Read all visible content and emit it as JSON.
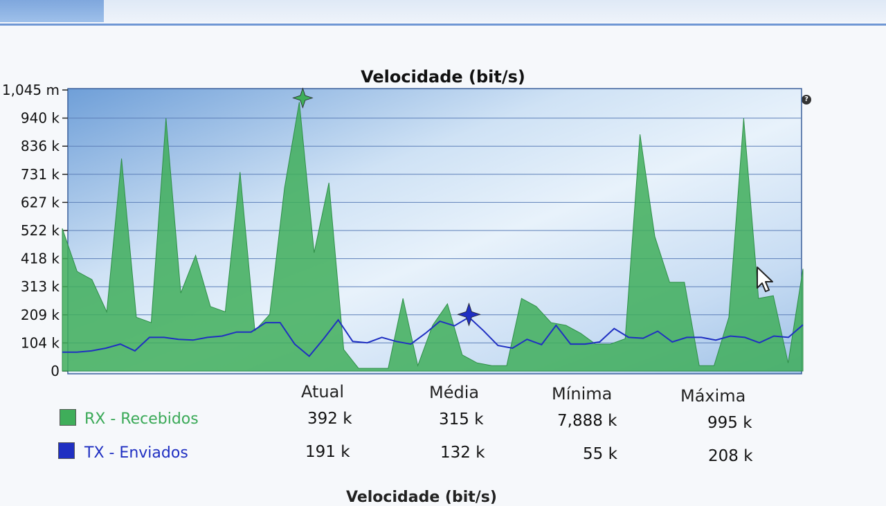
{
  "chart_data": {
    "type": "area",
    "title": "Velocidade (bit/s)",
    "y_ticks": [
      "1,045 m",
      "940 k",
      "836 k",
      "731 k",
      "627 k",
      "522 k",
      "418 k",
      "313 k",
      "209 k",
      "104 k",
      "0"
    ],
    "ylim": [
      0,
      1045000
    ],
    "grid": true,
    "legend_position": "bottom-left",
    "series": [
      {
        "name": "RX - Recebidos",
        "color": "#3fae5a",
        "values": [
          530000,
          370000,
          340000,
          220000,
          790000,
          200000,
          180000,
          940000,
          290000,
          430000,
          240000,
          220000,
          740000,
          150000,
          210000,
          680000,
          1000000,
          440000,
          700000,
          80000,
          10000,
          10000,
          10000,
          270000,
          20000,
          170000,
          250000,
          60000,
          30000,
          20000,
          20000,
          270000,
          240000,
          180000,
          170000,
          140000,
          100000,
          100000,
          120000,
          880000,
          500000,
          330000,
          330000,
          20000,
          20000,
          200000,
          940000,
          270000,
          280000,
          30000,
          380000
        ]
      },
      {
        "name": "TX - Enviados",
        "color": "#1f2fc2",
        "values": [
          70000,
          70000,
          75000,
          85000,
          100000,
          75000,
          125000,
          125000,
          118000,
          115000,
          125000,
          130000,
          145000,
          145000,
          180000,
          180000,
          100000,
          55000,
          120000,
          190000,
          110000,
          105000,
          125000,
          110000,
          100000,
          140000,
          185000,
          168000,
          200000,
          150000,
          95000,
          85000,
          118000,
          98000,
          170000,
          100000,
          100000,
          108000,
          158000,
          125000,
          122000,
          148000,
          108000,
          125000,
          125000,
          115000,
          130000,
          125000,
          105000,
          130000,
          125000,
          172000
        ]
      }
    ],
    "markers": [
      {
        "series": "RX - Recebidos",
        "type": "max"
      },
      {
        "series": "TX - Enviados",
        "type": "max"
      }
    ]
  },
  "stats": {
    "headers": [
      "Atual",
      "Média",
      "Mínima",
      "Máxima"
    ],
    "rows": [
      {
        "label": "RX - Recebidos",
        "values": [
          "392 k",
          "315 k",
          "7,888 k",
          "995 k"
        ]
      },
      {
        "label": "TX - Enviados",
        "values": [
          "191 k",
          "132 k",
          "55 k",
          "208 k"
        ]
      }
    ]
  },
  "bottom_title": "Velocidade (bit/s)",
  "help_icon": "?"
}
